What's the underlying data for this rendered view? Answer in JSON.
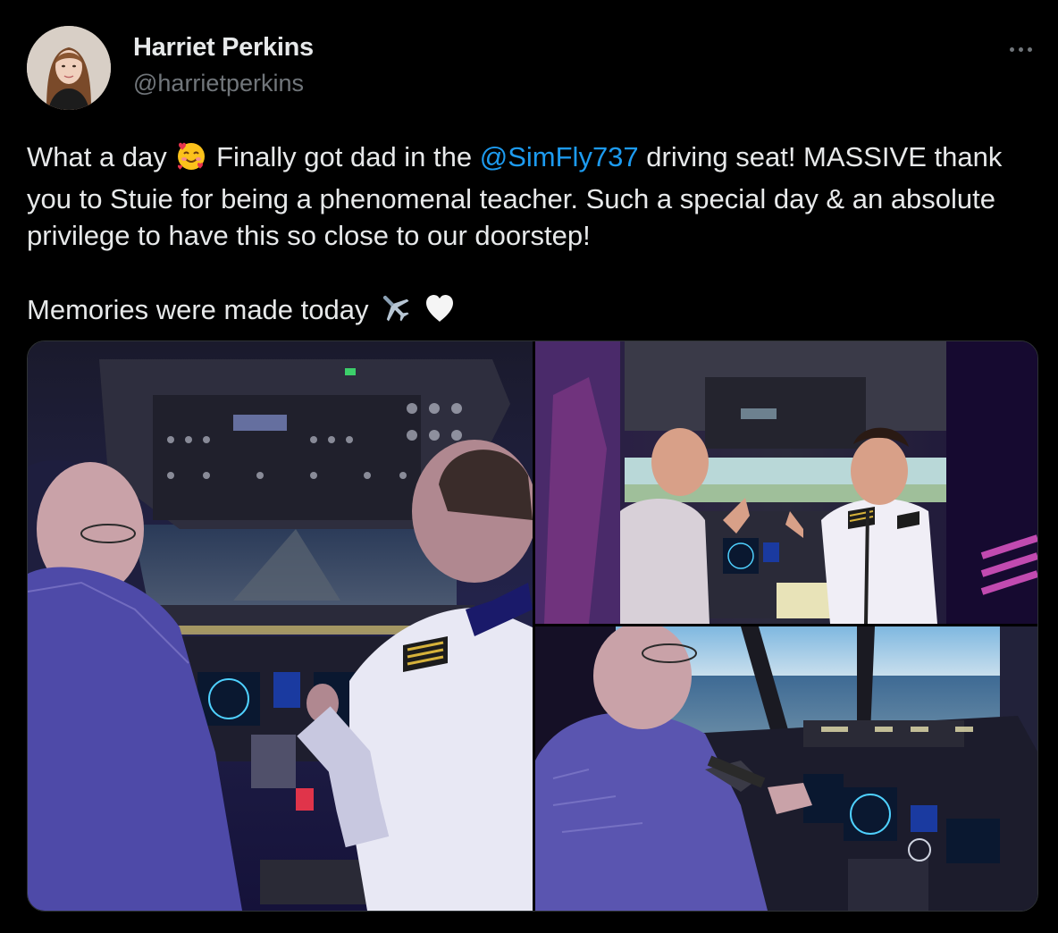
{
  "user": {
    "display_name": "Harriet Perkins",
    "handle": "@harrietperkins",
    "avatar_icon": "profile-photo"
  },
  "menu": {
    "more_icon": "more-horizontal-icon"
  },
  "tweet": {
    "part1": "What a day",
    "emoji1": "smiling-face-with-hearts-emoji",
    "part2": "Finally got dad in the",
    "mention": "@SimFly737",
    "part3": "driving seat! MASSIVE thank you to Stuie for being a phenomenal teacher. Such a special day & an absolute privilege to have this so close to our doorstep!",
    "part4": "Memories were made today",
    "emoji2": "airplane-emoji",
    "emoji3": "white-heart-emoji"
  },
  "media": {
    "count": 3,
    "photos": [
      {
        "name": "cockpit-rear-view-photo"
      },
      {
        "name": "two-pilots-thumbs-up-photo"
      },
      {
        "name": "dad-at-controls-photo"
      }
    ]
  },
  "colors": {
    "background": "#000000",
    "text": "#e7e9ea",
    "secondary": "#71767b",
    "link": "#1d9bf0",
    "border": "#2f3336"
  }
}
